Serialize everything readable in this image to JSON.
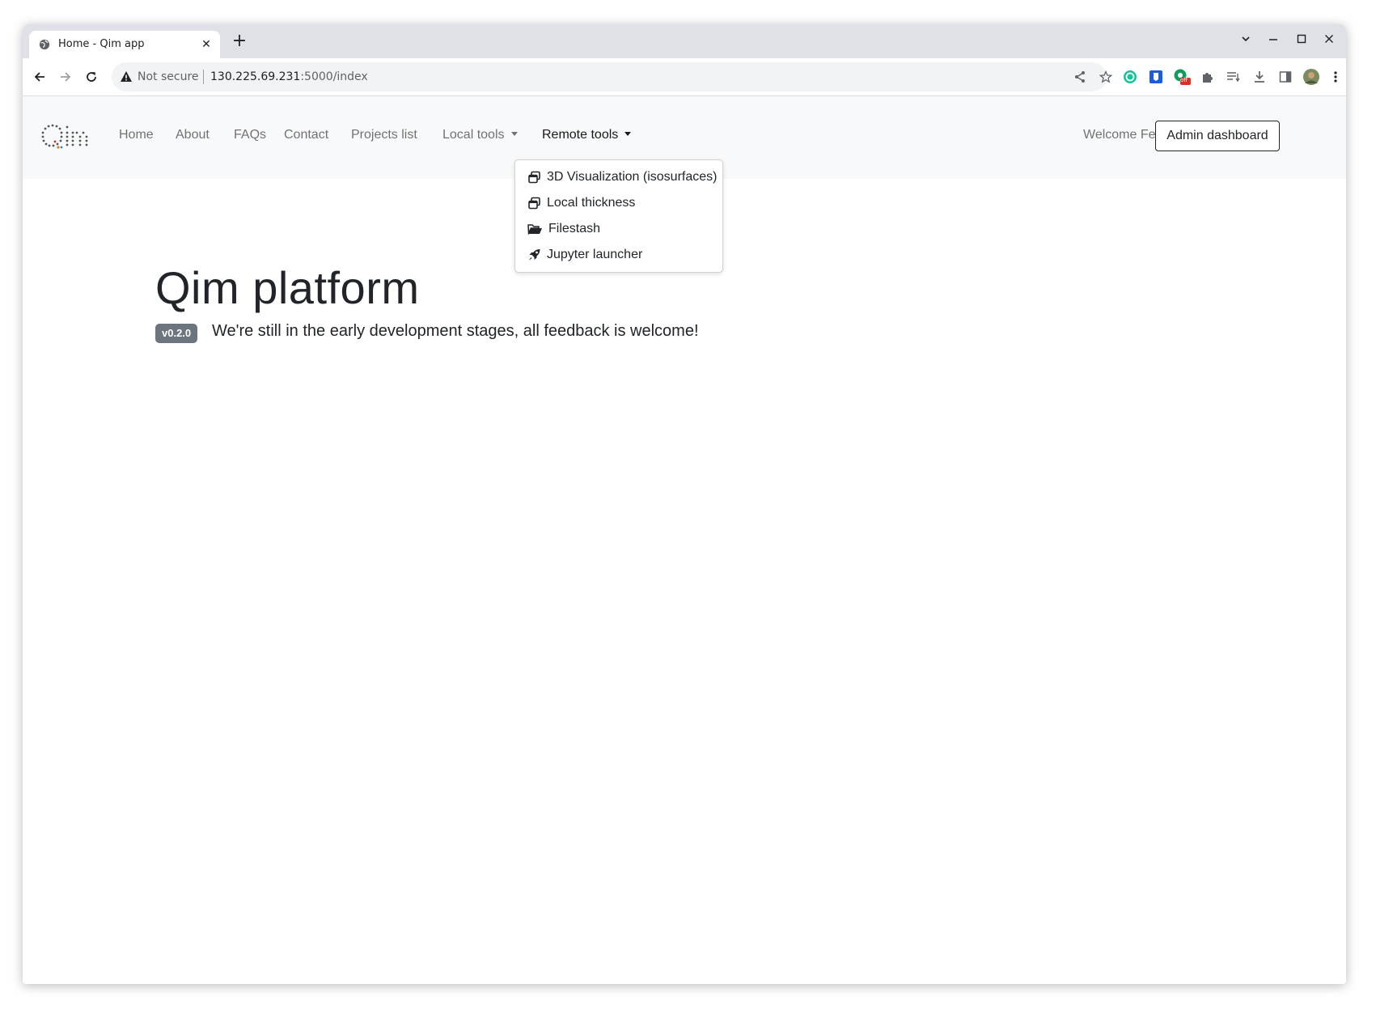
{
  "browser": {
    "tab_title": "Home - Qim app",
    "new_tab_label": "+",
    "security_label": "Not secure",
    "url_host": "130.225.69.231",
    "url_path": ":5000/index",
    "extension_badge": "off"
  },
  "navbar": {
    "brand": "Qim",
    "links": [
      {
        "label": "Home"
      },
      {
        "label": "About"
      },
      {
        "label": "FAQs"
      },
      {
        "label": "Contact"
      },
      {
        "label": "Projects list"
      },
      {
        "label": "Local tools"
      },
      {
        "label": "Remote tools"
      }
    ],
    "welcome_label": "Welcome Felipe",
    "admin_button": "Admin dashboard"
  },
  "remote_tools_menu": {
    "items": [
      {
        "label": "3D Visualization (isosurfaces)",
        "icon": "window-restore-icon"
      },
      {
        "label": "Local thickness",
        "icon": "window-restore-icon"
      },
      {
        "label": "Filestash",
        "icon": "folder-open-icon"
      },
      {
        "label": "Jupyter launcher",
        "icon": "rocket-icon"
      }
    ]
  },
  "hero": {
    "title": "Qim platform",
    "version_badge": "v0.2.0",
    "lead": "We're still in the early development stages, all feedback is welcome!"
  }
}
